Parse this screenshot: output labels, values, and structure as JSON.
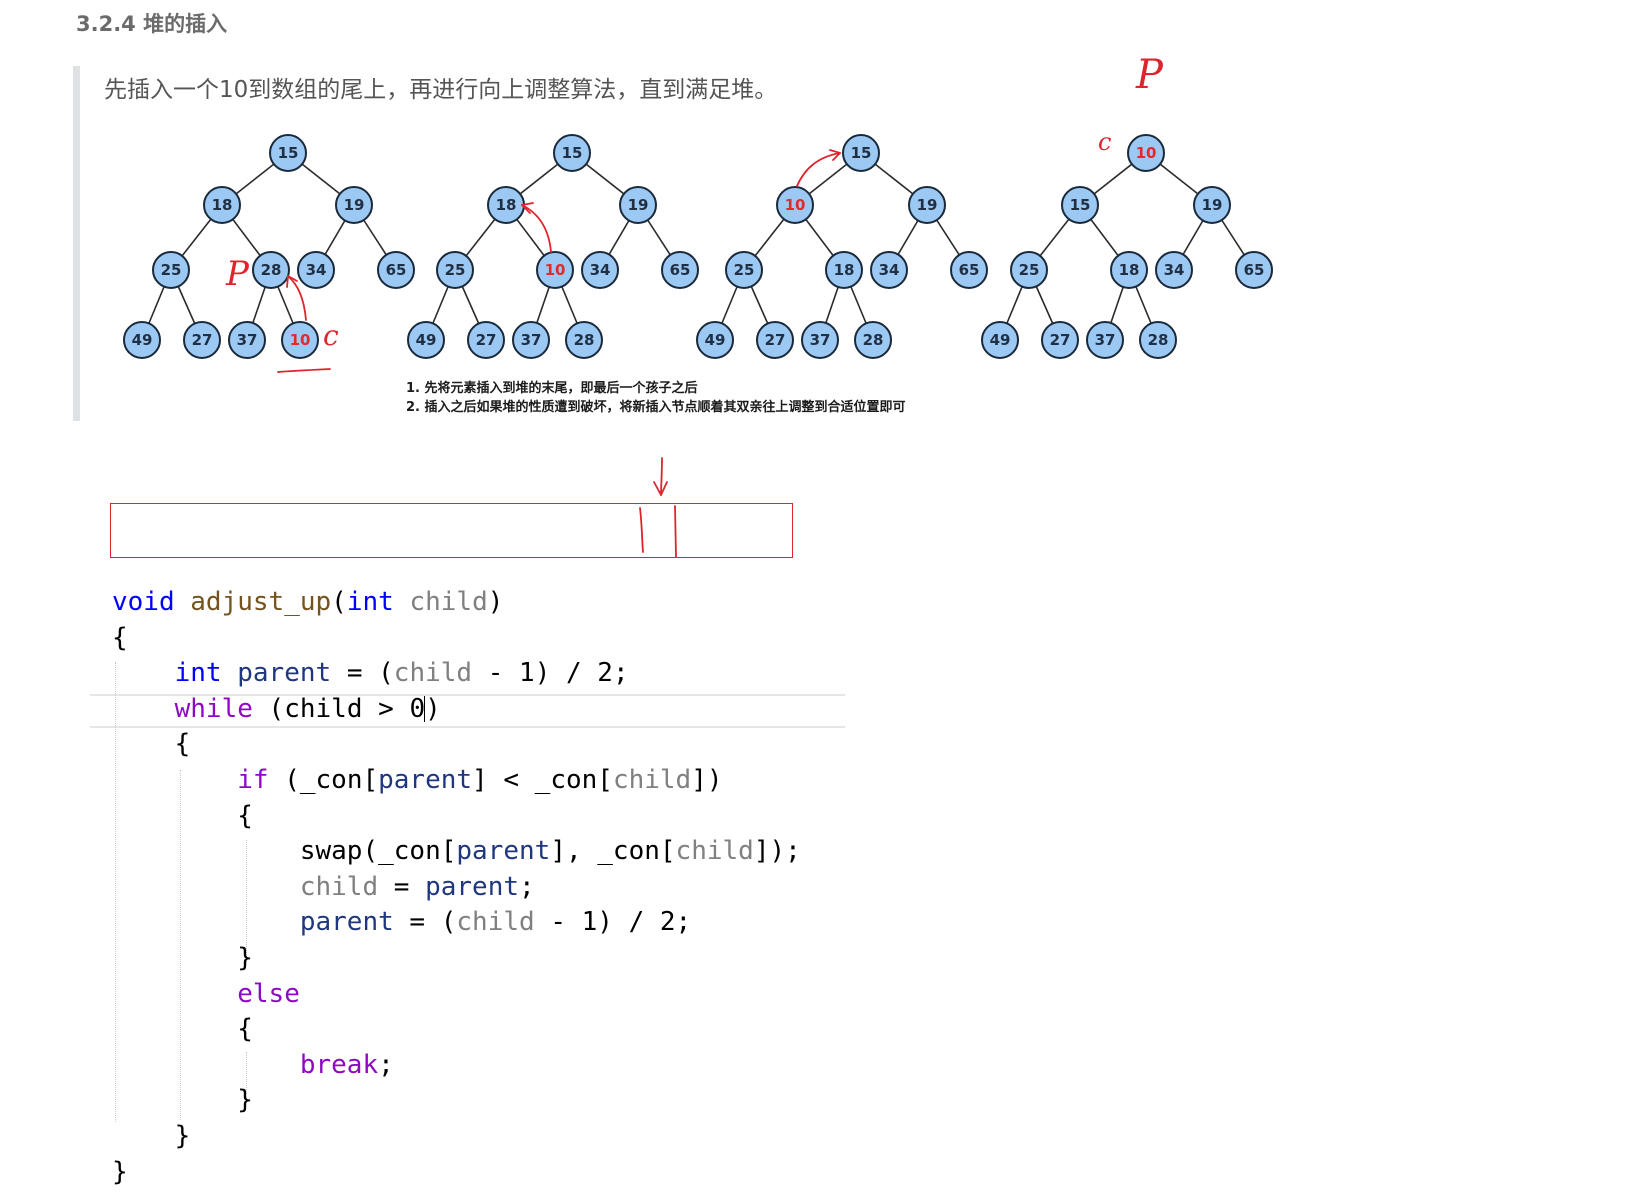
{
  "heading": "3.2.4 堆的插入",
  "quote_text": "先插入一个10到数组的尾上，再进行向上调整算法，直到满足堆。",
  "trees": [
    {
      "nodes": [
        {
          "label": "15",
          "hl": false
        },
        {
          "label": "18",
          "hl": false
        },
        {
          "label": "19",
          "hl": false
        },
        {
          "label": "25",
          "hl": false
        },
        {
          "label": "28",
          "hl": false
        },
        {
          "label": "34",
          "hl": false
        },
        {
          "label": "65",
          "hl": false
        },
        {
          "label": "49",
          "hl": false
        },
        {
          "label": "27",
          "hl": false
        },
        {
          "label": "37",
          "hl": false
        },
        {
          "label": "10",
          "hl": true
        }
      ]
    },
    {
      "nodes": [
        {
          "label": "15",
          "hl": false
        },
        {
          "label": "18",
          "hl": false
        },
        {
          "label": "19",
          "hl": false
        },
        {
          "label": "25",
          "hl": false
        },
        {
          "label": "10",
          "hl": true
        },
        {
          "label": "34",
          "hl": false
        },
        {
          "label": "65",
          "hl": false
        },
        {
          "label": "49",
          "hl": false
        },
        {
          "label": "27",
          "hl": false
        },
        {
          "label": "37",
          "hl": false
        },
        {
          "label": "28",
          "hl": false
        }
      ]
    },
    {
      "nodes": [
        {
          "label": "15",
          "hl": false
        },
        {
          "label": "10",
          "hl": true
        },
        {
          "label": "19",
          "hl": false
        },
        {
          "label": "25",
          "hl": false
        },
        {
          "label": "18",
          "hl": false
        },
        {
          "label": "34",
          "hl": false
        },
        {
          "label": "65",
          "hl": false
        },
        {
          "label": "49",
          "hl": false
        },
        {
          "label": "27",
          "hl": false
        },
        {
          "label": "37",
          "hl": false
        },
        {
          "label": "28",
          "hl": false
        }
      ]
    },
    {
      "nodes": [
        {
          "label": "10",
          "hl": true
        },
        {
          "label": "15",
          "hl": false
        },
        {
          "label": "19",
          "hl": false
        },
        {
          "label": "25",
          "hl": false
        },
        {
          "label": "18",
          "hl": false
        },
        {
          "label": "34",
          "hl": false
        },
        {
          "label": "65",
          "hl": false
        },
        {
          "label": "49",
          "hl": false
        },
        {
          "label": "27",
          "hl": false
        },
        {
          "label": "37",
          "hl": false
        },
        {
          "label": "28",
          "hl": false
        }
      ]
    }
  ],
  "captions": [
    "1. 先将元素插入到堆的末尾，即最后一个孩子之后",
    "2. 插入之后如果堆的性质遭到破坏，将新插入节点顺着其双亲往上调整到合适位置即可"
  ],
  "annotations": {
    "p": "P",
    "c": "c"
  },
  "code": {
    "sig_void": "void",
    "sig_name": "adjust_up",
    "sig_open": "(",
    "sig_int": "int",
    "sig_param": "child",
    "sig_close": ")",
    "brace_open": "{",
    "brace_close": "}",
    "l3_int": "int",
    "l3_var": "parent",
    "l3_eq": " = (",
    "l3_child": "child",
    "l3_rest": " - 1) / 2;",
    "l4_while": "while",
    "l4_mid": " (child > 0",
    "l4_end": ")",
    "l6_if": "if",
    "l6_a": " (_con[",
    "l6_parent": "parent",
    "l6_b": "] < _con[",
    "l6_child": "child",
    "l6_c": "])",
    "l8_a": "swap(_con[",
    "l8_parent": "parent",
    "l8_b": "], _con[",
    "l8_child": "child",
    "l8_c": "]);",
    "l9_child": "child",
    "l9_eq": " = ",
    "l9_parent": "parent",
    "l9_semi": ";",
    "l10_parent": "parent",
    "l10_eq": " = (",
    "l10_child": "child",
    "l10_rest": " - 1) / 2;",
    "l12_else": "else",
    "l14_break": "break",
    "l14_semi": ";"
  }
}
